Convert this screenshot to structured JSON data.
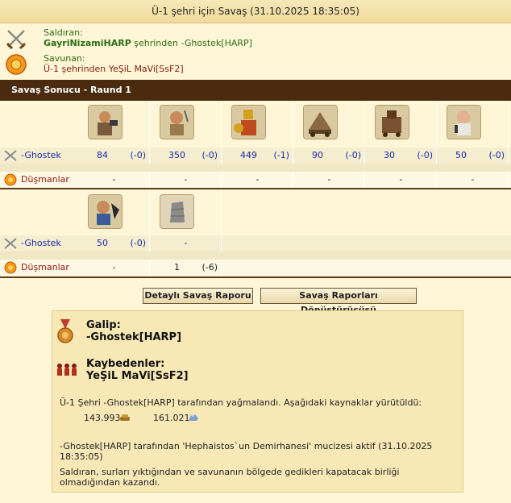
{
  "title": "Ü-1 şehri için Savaş (31.10.2025 18:35:05)",
  "attacker": {
    "label": "Saldıran:",
    "player": "GayriNizamiHARP",
    "mid": " şehrinden ",
    "city": "-Ghostek[HARP]"
  },
  "defender": {
    "label": "Savunan:",
    "text": "Ü-1 şehrinden YeŞiL MaVi[SsF2]"
  },
  "section_title": "Savaş Sonucu - Raund 1",
  "rows_label_attacker": "-Ghostek",
  "rows_label_defender": "Düşmanlar",
  "group1": {
    "units": [
      "hoplite-icon",
      "swordsman-icon",
      "spartan-icon",
      "ram-icon",
      "catapult-icon",
      "slinger-icon"
    ],
    "attacker": [
      {
        "count": "84",
        "loss": "(-0)"
      },
      {
        "count": "350",
        "loss": "(-0)"
      },
      {
        "count": "449",
        "loss": "(-1)"
      },
      {
        "count": "90",
        "loss": "(-0)"
      },
      {
        "count": "30",
        "loss": "(-0)"
      },
      {
        "count": "50",
        "loss": "(-0)"
      }
    ],
    "defender": [
      "-",
      "-",
      "-",
      "-",
      "-",
      "-"
    ]
  },
  "group2": {
    "units": [
      "cook-icon",
      "wall-icon"
    ],
    "attacker": [
      {
        "count": "50",
        "loss": "(-0)"
      },
      {
        "count": "-",
        "loss": ""
      }
    ],
    "defender": [
      {
        "count": "-",
        "loss": ""
      },
      {
        "count": "1",
        "loss": "(-6)"
      }
    ]
  },
  "buttons": {
    "detailed": "Detaylı Savaş Raporu",
    "converter": "Savaş Raporları Dönüştürücüsü"
  },
  "result": {
    "winner_label": "Galip:",
    "winner": "-Ghostek[HARP]",
    "loser_label": "Kaybedenler:",
    "loser": "YeŞiL MaVi[SsF2]",
    "plunder_text": "Ü-1 Şehri -Ghostek[HARP] tarafından yağmalandı. Aşağıdaki kaynaklar yürütüldü:",
    "resource1": "143.993",
    "resource2": "161.021",
    "wonder_text": "-Ghostek[HARP] tarafından 'Hephaistos`un Demirhanesi' mucizesi aktif (31.10.2025 18:35:05)",
    "wall_text": "Saldıran, surları yıktığından ve savunanın bölgede gedikleri kapatacak birliği olmadığından kazandı."
  },
  "colors": {
    "header": "#4b2b0f",
    "background": "#fef6d6",
    "green": "#2a6e16",
    "red": "#8b1a0e",
    "blue": "#1c2aa8"
  }
}
